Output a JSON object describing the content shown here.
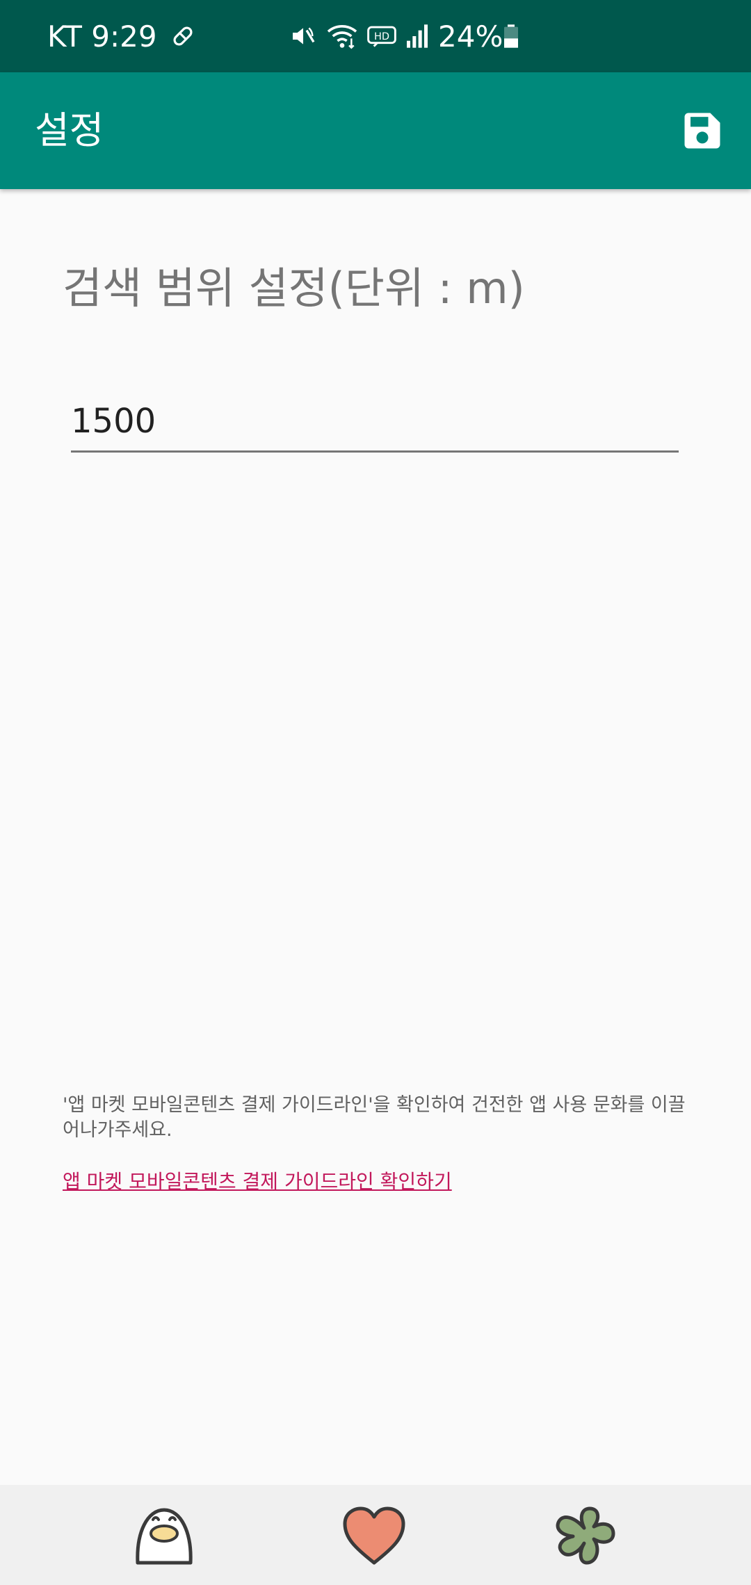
{
  "status_bar": {
    "carrier_time": "KT 9:29",
    "battery": "24%"
  },
  "app_bar": {
    "title": "설정",
    "save_icon": "save-icon"
  },
  "settings": {
    "heading": "검색 범위 설정(단위 : m)",
    "range_value": "1500"
  },
  "guide": {
    "notice": "'앱 마켓 모바일콘텐츠 결제 가이드라인'을 확인하여 건전한 앱 사용 문화를 이끌어나가주세요.",
    "link": "앱 마켓 모바일콘텐츠 결제 가이드라인 확인하기"
  },
  "bottom_nav": {
    "items": [
      "penguin-icon",
      "heart-icon",
      "clover-icon"
    ]
  },
  "colors": {
    "status_bar": "#00584d",
    "app_bar": "#00897b",
    "link": "#c2185b",
    "heart": "#ec8c72",
    "clover": "#8fab7a"
  }
}
